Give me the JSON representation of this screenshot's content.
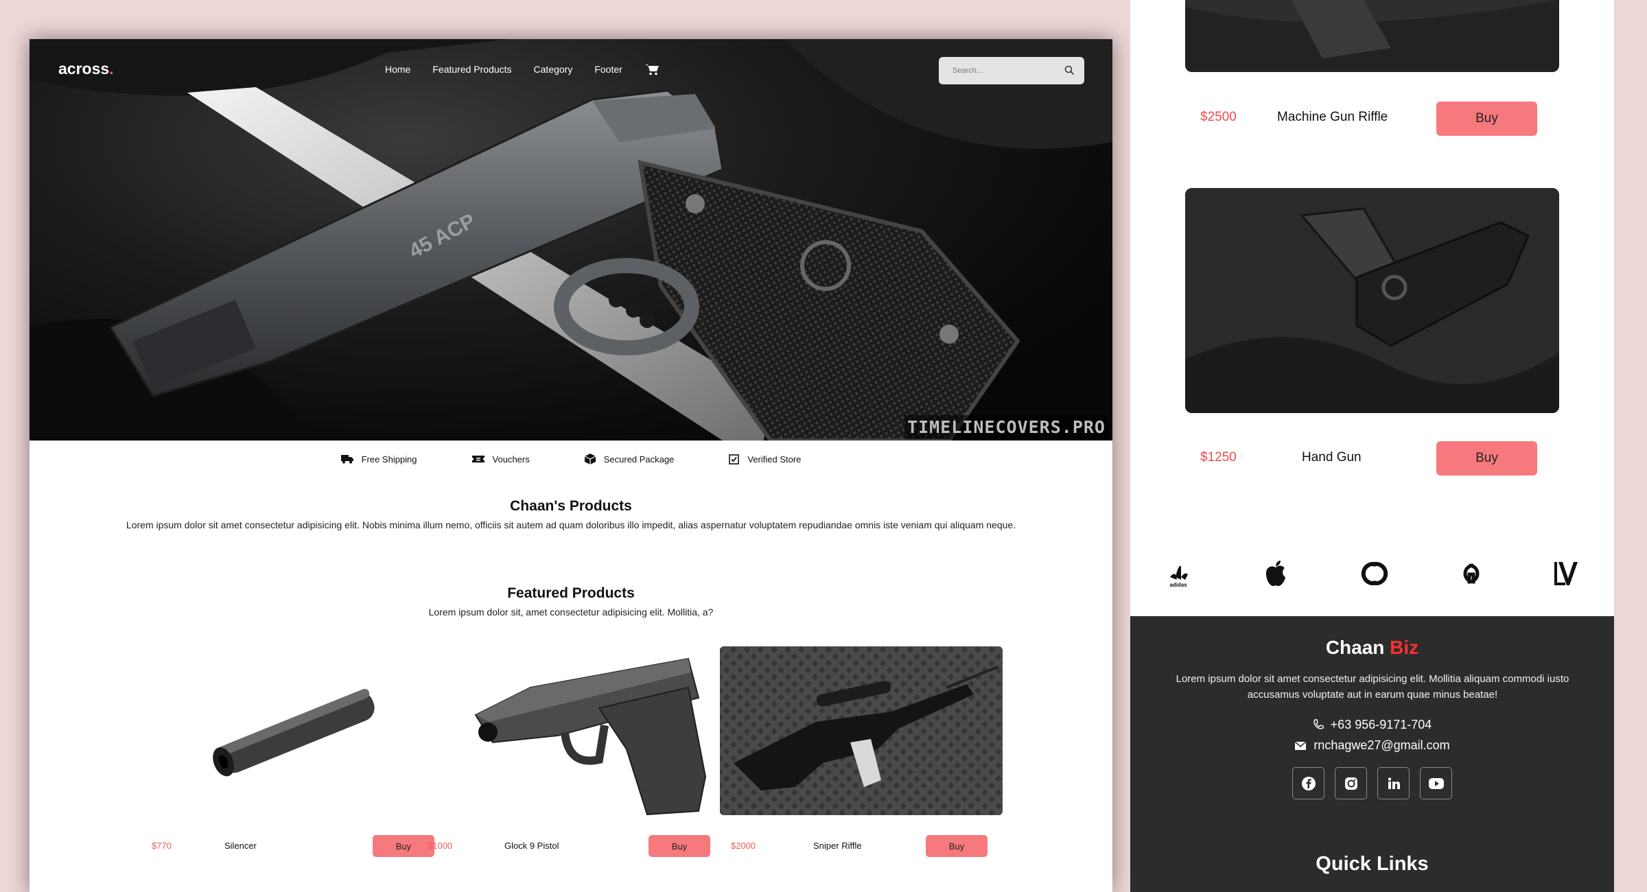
{
  "site": {
    "logo": "across",
    "logo_dot": ".",
    "nav": [
      "Home",
      "Featured Products",
      "Category",
      "Footer"
    ],
    "search_placeholder": "Search...",
    "hero_watermark": "TIMELINECOVERS.PRO"
  },
  "features": [
    "Free Shipping",
    "Vouchers",
    "Secured Package",
    "Verified Store"
  ],
  "products_section": {
    "title": "Chaan's Products",
    "text": "Lorem ipsum dolor sit amet consectetur adipisicing elit. Nobis minima illum nemo, officiis sit autem ad quam doloribus illo impedit, alias aspernatur voluptatem repudiandae omnis iste veniam qui aliquam neque."
  },
  "featured_section": {
    "title": "Featured Products",
    "text": "Lorem ipsum dolor sit, amet consectetur adipisicing elit. Mollitia, a?",
    "items": [
      {
        "price": "$770",
        "name": "Silencer",
        "button": "Buy"
      },
      {
        "price": "$1000",
        "name": "Glock 9 Pistol",
        "button": "Buy"
      },
      {
        "price": "$2000",
        "name": "Sniper Riffle",
        "button": "Buy"
      }
    ]
  },
  "mobile": {
    "items": [
      {
        "price": "$2500",
        "name": "Machine Gun Riffle",
        "button": "Buy"
      },
      {
        "price": "$1250",
        "name": "Hand Gun",
        "button": "Buy"
      }
    ],
    "brands": [
      "adidas",
      "apple",
      "chanel",
      "gucci",
      "louis-vuitton"
    ],
    "brand_adidas_text": "adidas",
    "footer": {
      "title": "Chaan",
      "title_accent": "Biz",
      "text": "Lorem ipsum dolor sit amet consectetur adipisicing elit. Mollitia aliquam commodi iusto accusamus voluptate aut in earum quae minus beatae!",
      "phone": "+63 956-9171-704",
      "email": "rnchagwe27@gmail.com",
      "socials": [
        "facebook-icon",
        "instagram-icon",
        "linkedin-icon",
        "youtube-icon"
      ],
      "quick_links": "Quick Links"
    }
  },
  "colors": {
    "accent": "#f6797d",
    "price": "#ef5b5b",
    "footer_bg": "#2c2c2c",
    "page_bg": "#ecd6d6"
  }
}
